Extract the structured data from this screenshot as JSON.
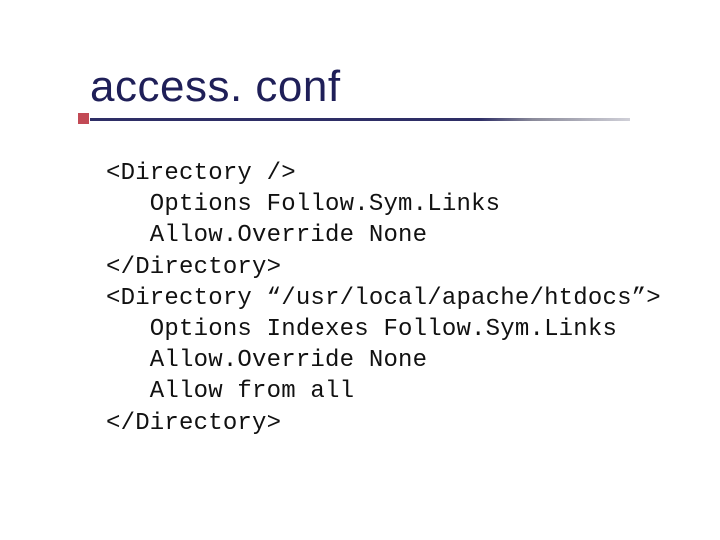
{
  "title": "access. conf",
  "code": {
    "l1": "<Directory />",
    "l2": "   Options Follow.Sym.Links",
    "l3": "   Allow.Override None",
    "l4": "</Directory>",
    "l5": "<Directory “/usr/local/apache/htdocs”>",
    "l6": "   Options Indexes Follow.Sym.Links",
    "l7": "   Allow.Override None",
    "l8": "   Allow from all",
    "l9": "</Directory>"
  }
}
